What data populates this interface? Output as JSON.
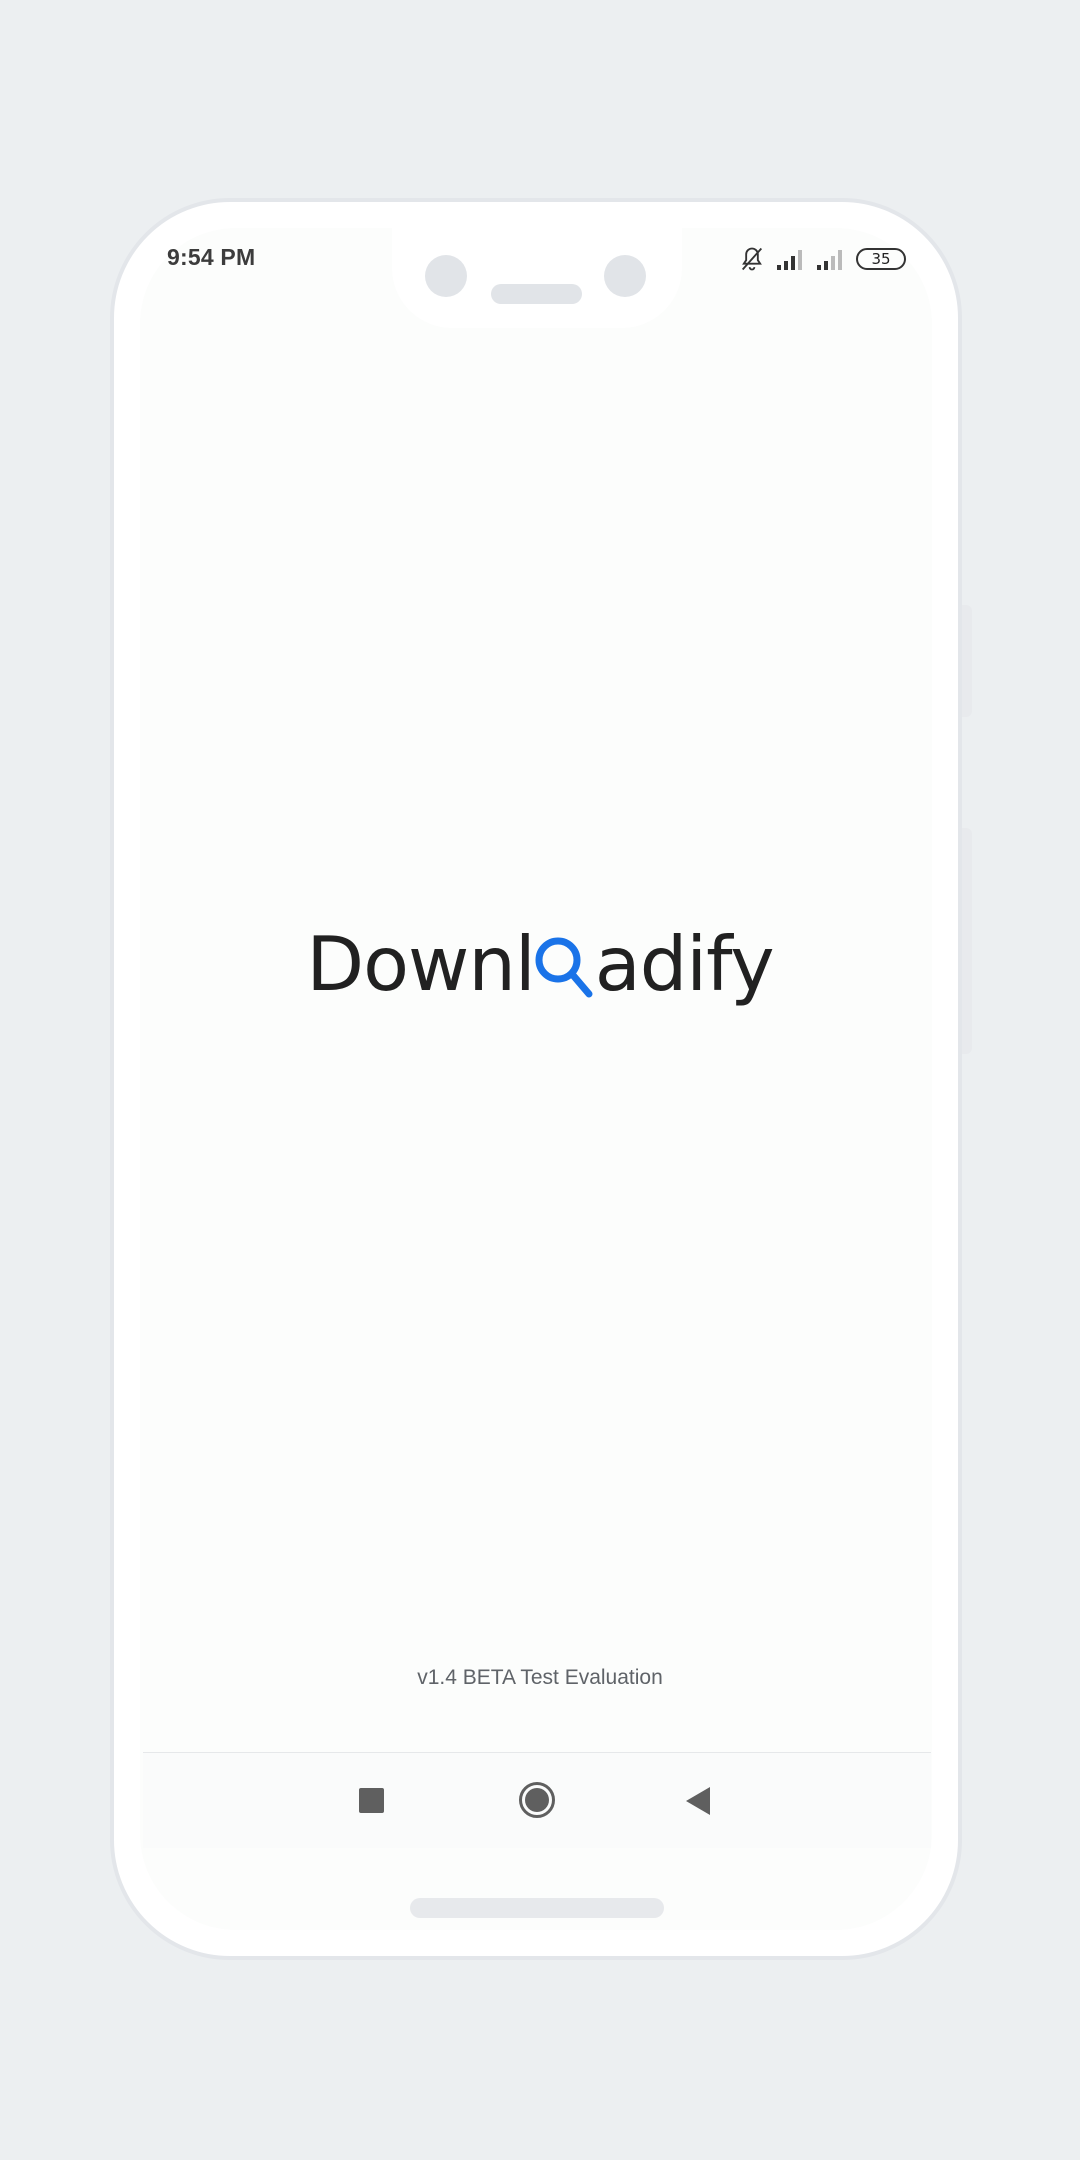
{
  "status_bar": {
    "time": "9:54 PM",
    "icons": [
      "bell-off-icon",
      "signal-icon",
      "signal-icon"
    ],
    "battery": "35"
  },
  "splash": {
    "logo_text_before": "Downl",
    "logo_text_after": "adify",
    "logo_glyph": "search-icon",
    "accent_color": "#1a73e8",
    "version": "v1.4 BETA Test Evaluation"
  },
  "navigation": {
    "buttons": [
      "recents-icon",
      "home-icon",
      "back-icon"
    ]
  }
}
